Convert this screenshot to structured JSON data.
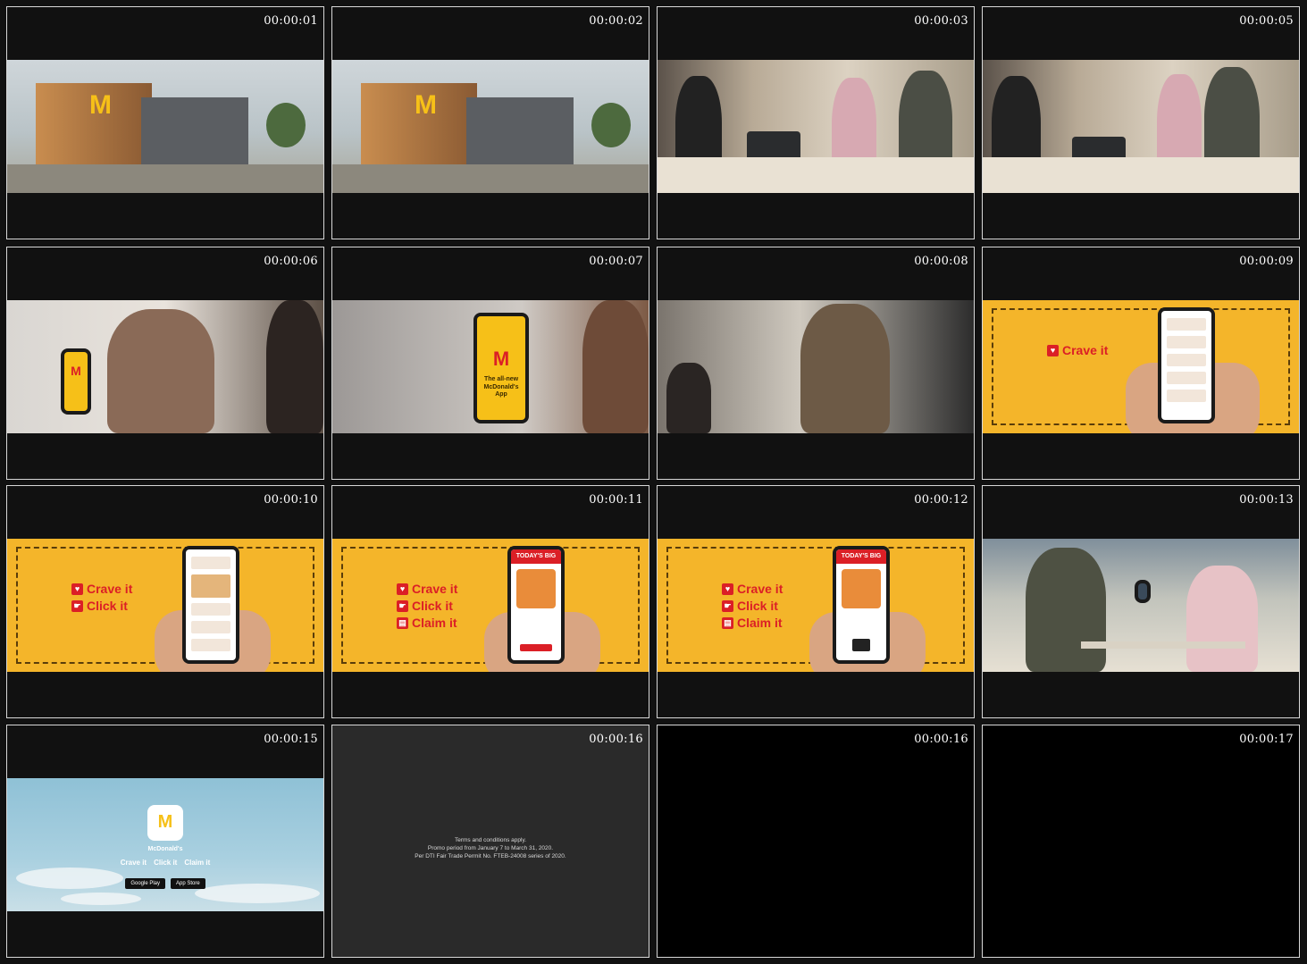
{
  "frames": [
    {
      "timestamp": "00:00:01",
      "scene": "restaurant-exterior",
      "sign_text": "McDonald's"
    },
    {
      "timestamp": "00:00:02",
      "scene": "restaurant-exterior",
      "sign_text": "McDonald's"
    },
    {
      "timestamp": "00:00:03",
      "scene": "counter-interior"
    },
    {
      "timestamp": "00:00:05",
      "scene": "counter-interior"
    },
    {
      "timestamp": "00:00:06",
      "scene": "woman-holding-phone"
    },
    {
      "timestamp": "00:00:07",
      "scene": "app-phone-closeup",
      "phone_caption": "The all-new McDonald's App"
    },
    {
      "timestamp": "00:00:08",
      "scene": "young-man-smiling"
    },
    {
      "timestamp": "00:00:09",
      "scene": "promo-crave",
      "tags": [
        "Crave it"
      ]
    },
    {
      "timestamp": "00:00:10",
      "scene": "promo-click",
      "tags": [
        "Crave it",
        "Click it"
      ]
    },
    {
      "timestamp": "00:00:11",
      "scene": "promo-claim",
      "tags": [
        "Crave it",
        "Click it",
        "Claim it"
      ],
      "deal_title": "TODAY'S BIG DEAL"
    },
    {
      "timestamp": "00:00:12",
      "scene": "promo-claim",
      "tags": [
        "Crave it",
        "Click it",
        "Claim it"
      ],
      "deal_title": "TODAY'S BIG DEAL"
    },
    {
      "timestamp": "00:00:13",
      "scene": "couple-at-table"
    },
    {
      "timestamp": "00:00:15",
      "scene": "app-endcard",
      "app_name": "McDonald's",
      "tags": [
        "Crave it",
        "Click it",
        "Claim it"
      ],
      "stores": [
        "Google Play",
        "App Store"
      ]
    },
    {
      "timestamp": "00:00:16",
      "scene": "legal-text",
      "legal": [
        "Terms and conditions apply.",
        "Promo period from January 7 to March 31, 2020.",
        "Per DTI Fair Trade Permit No. FTEB-24008 series of 2020."
      ]
    },
    {
      "timestamp": "00:00:16",
      "scene": "black"
    },
    {
      "timestamp": "00:00:17",
      "scene": "black"
    }
  ],
  "colors": {
    "brand_yellow": "#f4b52a",
    "brand_red": "#db1f26",
    "frame_border": "#d8d8d8",
    "background": "#111111"
  }
}
